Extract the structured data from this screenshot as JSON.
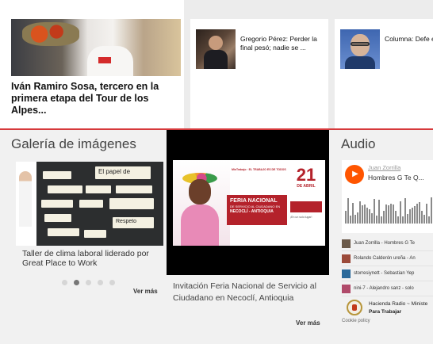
{
  "top_news": {
    "main": {
      "headline": "Iván Ramiro Sosa, tercero en la primera etapa del Tour de los Alpes..."
    },
    "side": [
      {
        "title": "Gregorio Pérez: Perder la final pesó; nadie se ..."
      },
      {
        "title": "Columna: Defe empleo - Minis Hacie..."
      }
    ]
  },
  "gallery": {
    "title": "Galería de imágenes",
    "board_cards": [
      "El papel de",
      "",
      "",
      "",
      "",
      "",
      "",
      "",
      "",
      "Respeto",
      "",
      ""
    ],
    "caption": "Taller de clima laboral liderado por Great Place to Work",
    "dots": 5,
    "active_dot": 1,
    "more_label": "Ver más"
  },
  "video": {
    "slide": {
      "logos": "MinTrabajo · EL TRABAJO ES DE TODOS",
      "banner_title": "FERIA NACIONAL",
      "banner_sub": "DE SERVICIO AL CIUDADANO EN",
      "banner_place": "NECOCLÍ - ANTIOQUIA",
      "day": "21",
      "month": "DE ABRIL",
      "aside": "¡En un solo lugar!"
    },
    "caption": "Invitación Feria Nacional de Servicio al Ciudadano en Necoclí, Antioquia",
    "more_label": "Ver más"
  },
  "audio": {
    "title": "Audio",
    "player": {
      "artist": "Juan Zorrilla",
      "track": "Hombres G Te Q..."
    },
    "playlist": [
      {
        "label": "Juan Zorrilla - Hombres G Te",
        "color": "#6b5a4a"
      },
      {
        "label": "Rolando Calderón ureña - An",
        "color": "#9b4a3a"
      },
      {
        "label": "storresiynett - Sebastian Yep",
        "color": "#2b6a9b"
      },
      {
        "label": "nini-7 - Alejandro sanz - solo",
        "color": "#b04a6a"
      }
    ],
    "footer": {
      "title": "Hacienda Radio ~ Ministe",
      "subtitle": "Para Trabajar"
    },
    "cookie": "Cookie policy"
  }
}
